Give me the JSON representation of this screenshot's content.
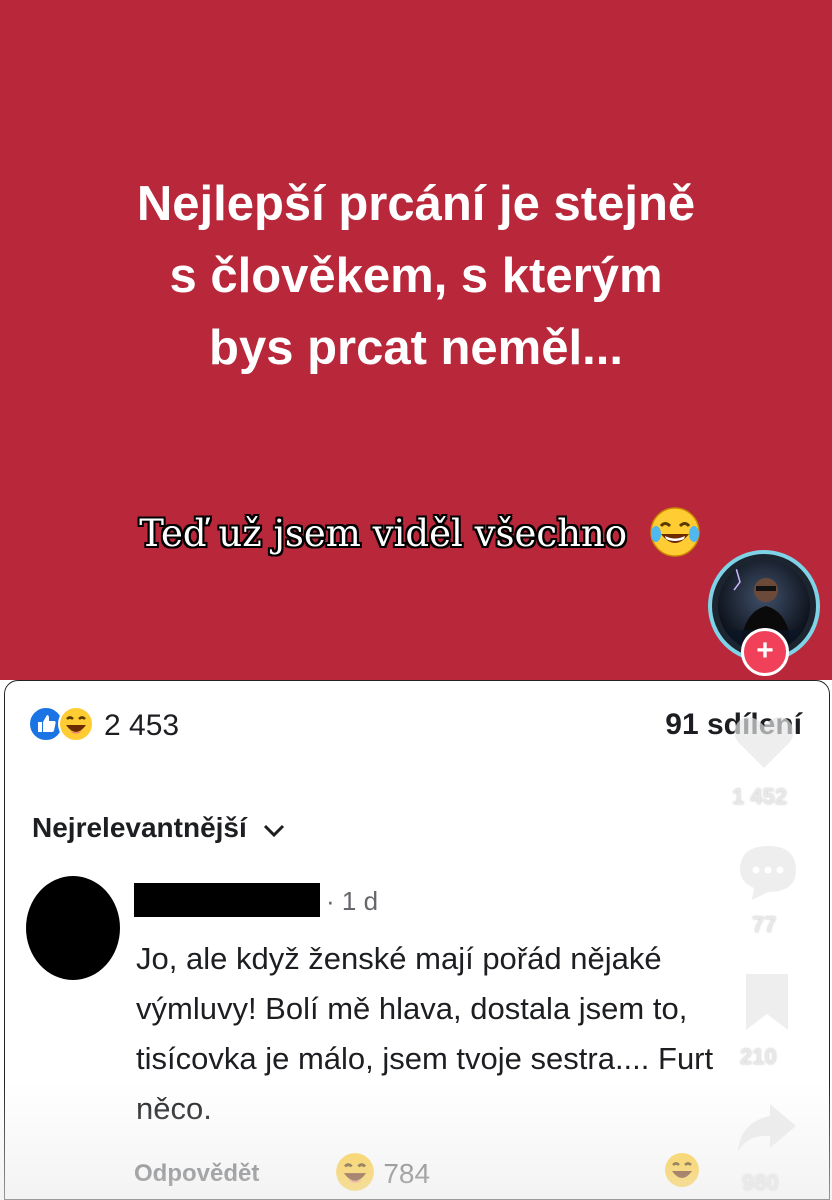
{
  "post": {
    "headline_lines": [
      "Nejlepší prcání je stejně",
      "s člověkem, s kterým",
      "bys prcat neměl..."
    ],
    "caption": "Teď už jsem viděl všechno",
    "background_color": "#b8273a"
  },
  "stats": {
    "reaction_count": "2 453",
    "shares": "91 sdílení"
  },
  "sort": {
    "label": "Nejrelevantnější"
  },
  "comment": {
    "time": "· 1 d",
    "text": "Jo, ale když ženské mají pořád nějaké výmluvy! Bolí mě hlava, dostala jsem to, tisícovka je málo, jsem tvoje sestra.... Furt něco.",
    "reply_label": "Odpovědět",
    "reaction_count": "784"
  },
  "overlay": {
    "likes": "1 452",
    "comments": "77",
    "saves": "210",
    "shares": "980"
  },
  "icons": {
    "like": "like-icon",
    "haha": "haha-icon",
    "chevron": "chevron-down-icon",
    "heart": "heart-icon",
    "comment": "comment-bubble-icon",
    "bookmark": "bookmark-icon",
    "share": "share-arrow-icon",
    "plus": "plus-icon"
  }
}
